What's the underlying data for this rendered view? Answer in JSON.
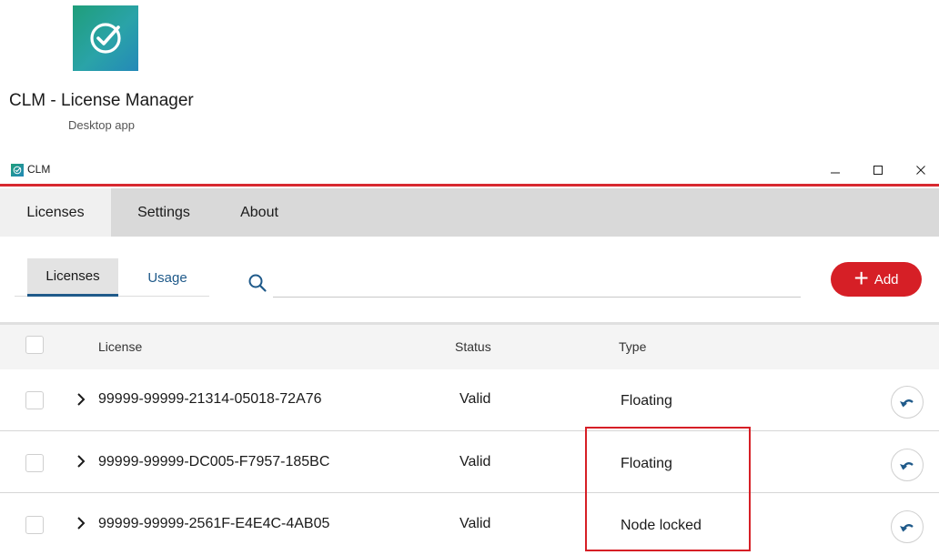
{
  "store": {
    "app_name": "CLM - License Manager",
    "app_kind": "Desktop app",
    "icon": "check-circle-icon"
  },
  "window": {
    "title": "CLM",
    "controls": [
      "minimize-icon",
      "maximize-icon",
      "close-icon"
    ]
  },
  "main_tabs": [
    {
      "label": "Licenses",
      "active": true
    },
    {
      "label": "Settings",
      "active": false
    },
    {
      "label": "About",
      "active": false
    }
  ],
  "sub_tabs": [
    {
      "label": "Licenses",
      "active": true
    },
    {
      "label": "Usage",
      "active": false
    }
  ],
  "search": {
    "value": "",
    "placeholder": ""
  },
  "add_button": {
    "label": "Add",
    "color": "#d61f26"
  },
  "table": {
    "columns": [
      "License",
      "Status",
      "Type"
    ],
    "rows": [
      {
        "license": "99999-99999-21314-05018-72A76",
        "status": "Valid",
        "type": "Floating"
      },
      {
        "license": "99999-99999-DC005-F7957-185BC",
        "status": "Valid",
        "type": "Floating"
      },
      {
        "license": "99999-99999-2561F-E4E4C-4AB05",
        "status": "Valid",
        "type": "Node locked"
      }
    ]
  },
  "colors": {
    "accent_red": "#d7282f",
    "link_blue": "#1f5a8a",
    "tab_bar_gray": "#d9d9d9"
  }
}
